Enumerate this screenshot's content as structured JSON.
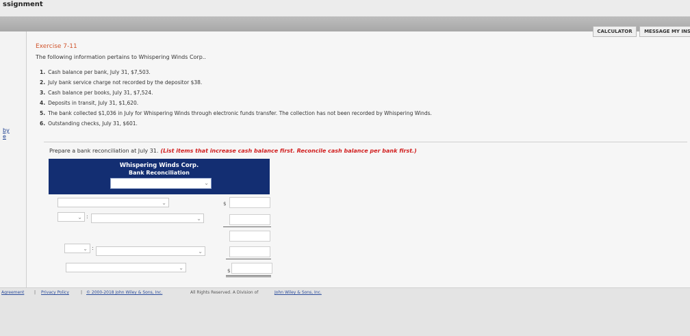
{
  "app": {
    "title": "ssignment"
  },
  "toolbar": {
    "calculator": "CALCULATOR",
    "message": "MESSAGE MY INS"
  },
  "left": {
    "link1": "by",
    "link2": "e"
  },
  "exercise": {
    "title": "Exercise 7-11",
    "intro": "The following information pertains to Whispering Winds Corp..",
    "items": [
      {
        "num": "1.",
        "text": "Cash balance per bank, July 31, $7,503."
      },
      {
        "num": "2.",
        "text": "July bank service charge not recorded by the depositor $38."
      },
      {
        "num": "3.",
        "text": "Cash balance per books, July 31, $7,524."
      },
      {
        "num": "4.",
        "text": "Deposits in transit, July 31, $1,620."
      },
      {
        "num": "5.",
        "text": "The bank collected $1,036 in July for Whispering Winds through electronic funds transfer. The collection has not been recorded by Whispering Winds."
      },
      {
        "num": "6.",
        "text": "Outstanding checks, July 31, $601."
      }
    ]
  },
  "prompt": {
    "text": "Prepare a bank reconciliation at July 31.",
    "instruction": "(List items that increase cash balance first. Reconcile cash balance per bank first.)"
  },
  "reconciliation": {
    "company": "Whispering Winds Corp.",
    "subtitle": "Bank Reconciliation",
    "currency": "$",
    "colon": ":"
  },
  "footer": {
    "agreement": "Agreement",
    "privacy": "Privacy Policy",
    "sep": "|",
    "copyright": "© 2000-2018 John Wiley & Sons, Inc.",
    "rights": "All Rights Reserved. A Division of",
    "company": "John Wiley & Sons, Inc."
  }
}
